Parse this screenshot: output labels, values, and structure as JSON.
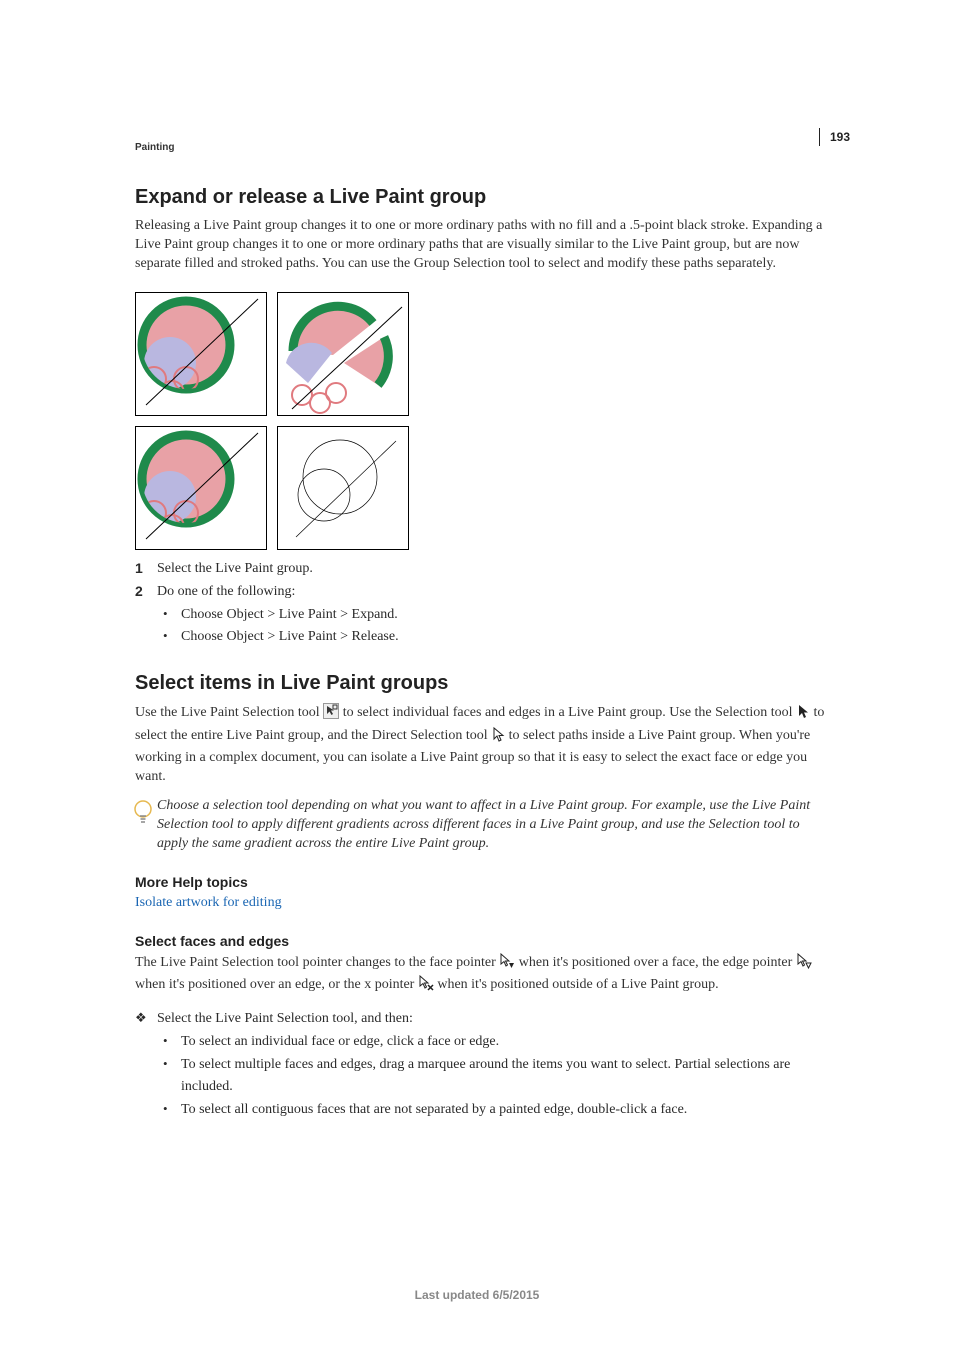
{
  "header": {
    "section": "Painting",
    "page_number": "193"
  },
  "section1": {
    "heading": "Expand or release a Live Paint group",
    "intro": "Releasing a Live Paint group changes it to one or more ordinary paths with no fill and a .5-point black stroke. Expanding a Live Paint group changes it to one or more ordinary paths that are visually similar to the Live Paint group, but are now separate filled and stroked paths. You can use the Group Selection tool to select and modify these paths separately.",
    "steps": [
      {
        "num": "1",
        "text": "Select the Live Paint group."
      },
      {
        "num": "2",
        "text": "Do one of the following:"
      }
    ],
    "step2_bullets": [
      "Choose Object > Live Paint > Expand.",
      "Choose Object > Live Paint > Release."
    ]
  },
  "section2": {
    "heading": "Select items in Live Paint groups",
    "para1_a": "Use the Live Paint Selection tool ",
    "para1_b": " to select individual faces and edges in a Live Paint group. Use the Selection tool ",
    "para1_c": " to select the entire Live Paint group, and the Direct Selection tool ",
    "para1_d": " to select paths inside a Live Paint group. When you're working in a complex document, you can isolate a Live Paint group so that it is easy to select the exact face or edge you want.",
    "tip": "Choose a selection tool depending on what you want to affect in a Live Paint group. For example, use the Live Paint Selection tool to apply different gradients across different faces in a Live Paint group, and use the Selection tool to apply the same gradient across the entire Live Paint group.",
    "more_help_heading": "More Help topics",
    "more_help_link": "Isolate artwork for editing"
  },
  "section3": {
    "heading": "Select faces and edges",
    "para_a": "The Live Paint Selection tool pointer changes to the face pointer ",
    "para_b": " when it's positioned over a face, the edge pointer ",
    "para_c": " when it's positioned over an edge, or the x pointer ",
    "para_d": " when it's positioned outside of a Live Paint group.",
    "diamond_line": "Select the Live Paint Selection tool, and then:",
    "bullets": [
      "To select an individual face or edge, click a face or edge.",
      "To select multiple faces and edges, drag a marquee around the items you want to select. Partial selections are included.",
      "To select all contiguous faces that are not separated by a painted edge, double-click a face."
    ]
  },
  "footer": {
    "text": "Last updated 6/5/2015"
  }
}
